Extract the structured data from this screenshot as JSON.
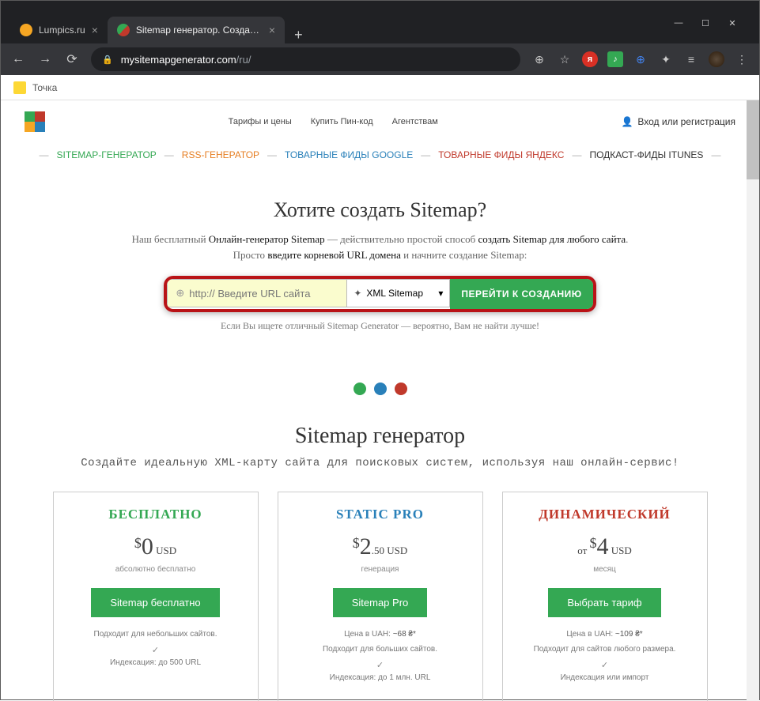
{
  "browser": {
    "tabs": [
      {
        "title": "Lumpics.ru",
        "favicon_color": "#f5a623"
      },
      {
        "title": "Sitemap генератор. Создайте XI",
        "favicon_color": "#34a853"
      }
    ],
    "url_prefix": "mysitemapgenerator.com",
    "url_path": "/ru/",
    "bookmark": "Точка"
  },
  "header": {
    "nav": [
      "Тарифы и цены",
      "Купить Пин-код",
      "Агентствам"
    ],
    "login": "Вход или регистрация"
  },
  "subnav": [
    {
      "label": "SITEMAP-ГЕНЕРАТОР",
      "color": "#34a853"
    },
    {
      "label": "RSS-ГЕНЕРАТОР",
      "color": "#e67e22"
    },
    {
      "label": "ТОВАРНЫЕ ФИДЫ GOOGLE",
      "color": "#2980b9"
    },
    {
      "label": "ТОВАРНЫЕ ФИДЫ ЯНДЕКС",
      "color": "#c0392b"
    },
    {
      "label": "ПОДКАСТ-ФИДЫ ITUNES",
      "color": "#333"
    }
  ],
  "hero": {
    "title": "Хотите создать Sitemap?",
    "sub1_a": "Наш бесплатный ",
    "sub1_b": "Онлайн-генератор Sitemap",
    "sub1_c": " — действительно простой способ ",
    "sub1_d": "создать Sitemap для любого сайта",
    "sub1_e": ".",
    "sub2_a": "Просто ",
    "sub2_b": "введите корневой URL домена",
    "sub2_c": " и начните создание Sitemap:",
    "input_placeholder": "http:// Введите URL сайта",
    "select_label": "XML Sitemap",
    "go_button": "ПЕРЕЙТИ К СОЗДАНИЮ",
    "footer": "Если Вы ищете отличный Sitemap Generator — вероятно, Вам не найти лучше!"
  },
  "dots": [
    "#34a853",
    "#2980b9",
    "#c0392b"
  ],
  "generator": {
    "title": "Sitemap генератор",
    "subtitle": "Создайте идеальную XML-карту сайта для поисковых систем, используя наш онлайн-сервис!"
  },
  "plans": [
    {
      "name": "БЕСПЛАТНО",
      "color": "#34a853",
      "price_pre": "",
      "price_num": "0",
      "price_cur": "USD",
      "note": "абсолютно бесплатно",
      "button": "Sitemap бесплатно",
      "desc": "Подходит для небольших сайтов.",
      "index": "Индексация: до 500 URL"
    },
    {
      "name": "STATIC PRO",
      "color": "#2980b9",
      "price_pre": "",
      "price_num": "2",
      "price_dec": ".50",
      "price_cur": "USD",
      "note": "генерация",
      "button": "Sitemap Pro",
      "uah_label": "Цена в UAH: ",
      "uah_val": "~68 ₴*",
      "desc": "Подходит для больших сайтов.",
      "index": "Индексация: до 1 млн. URL"
    },
    {
      "name": "ДИНАМИЧЕСКИЙ",
      "color": "#c0392b",
      "price_pre": "от ",
      "price_num": "4",
      "price_cur": "USD",
      "note": "месяц",
      "button": "Выбрать тариф",
      "uah_label": "Цена в UAH: ",
      "uah_val": "~109 ₴*",
      "desc": "Подходит для сайтов любого размера.",
      "index": "Индексация или импорт"
    }
  ]
}
